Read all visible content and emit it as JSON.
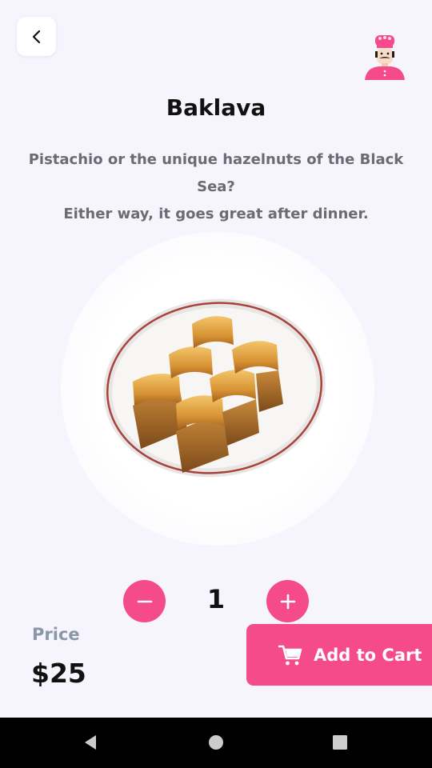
{
  "header": {
    "back_icon": "chevron-left-icon",
    "chef_icon": "chef-avatar-icon"
  },
  "product": {
    "title": "Baklava",
    "description_line1": "Pistachio or the unique hazelnuts of the Black Sea?",
    "description_line2": "Either way, it goes great after dinner.",
    "image": "baklava-plate-image"
  },
  "quantity": {
    "value": "1",
    "minus_icon": "minus-icon",
    "plus_icon": "plus-icon"
  },
  "price": {
    "label": "Price",
    "value": "$25"
  },
  "cart": {
    "label": "Add to Cart",
    "icon": "shopping-cart-icon"
  },
  "system_nav": {
    "items": [
      "back-icon",
      "home-icon",
      "recents-icon"
    ]
  },
  "colors": {
    "accent": "#f54b8a",
    "background": "#f6f4fc",
    "muted_text": "#6b6b74",
    "price_label": "#8a97a8"
  }
}
